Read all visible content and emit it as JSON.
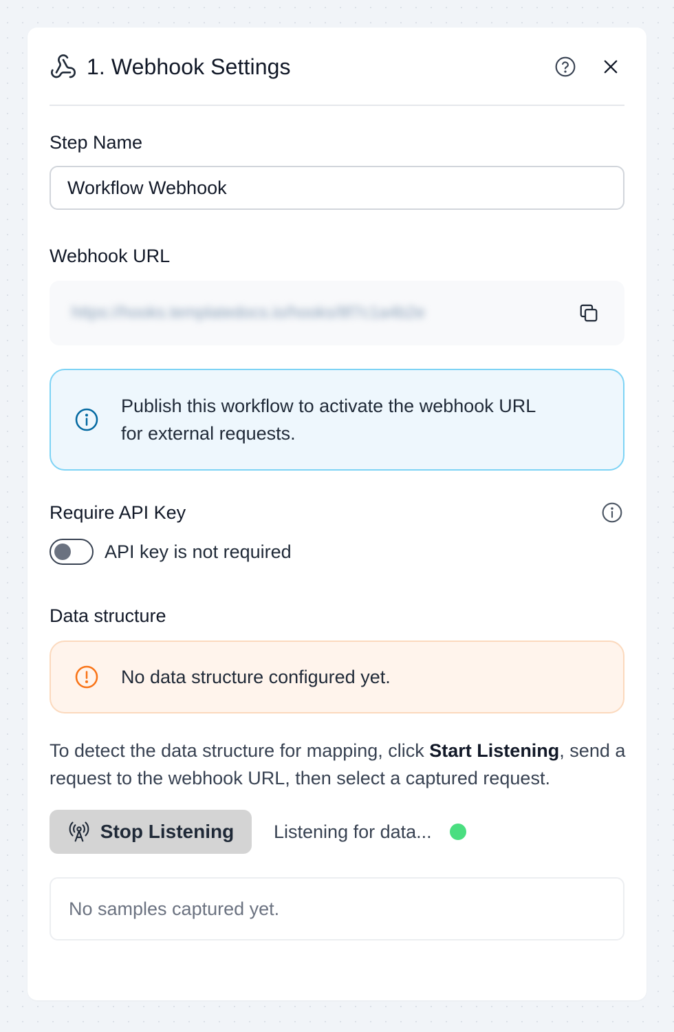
{
  "header": {
    "title": "1. Webhook Settings",
    "title_icon": "webhook-icon",
    "help_icon": "help-circle-icon",
    "close_icon": "close-icon"
  },
  "step_name": {
    "label": "Step Name",
    "value": "Workflow Webhook"
  },
  "webhook_url": {
    "label": "Webhook URL",
    "value": "https://hooks.templatedocs.io/hooks/8f7c1a4b2e",
    "copy_icon": "copy-icon"
  },
  "publish_notice": {
    "icon": "info-circle-icon",
    "line1": "Publish this workflow to activate the webhook URL",
    "line2": "for external requests."
  },
  "api_key": {
    "label": "Require API Key",
    "info_icon": "info-circle-icon",
    "toggle_on": false,
    "toggle_text": "API key is not required"
  },
  "data_structure": {
    "label": "Data structure",
    "warning_icon": "alert-circle-icon",
    "warning": "No data structure configured yet.",
    "desc_before": "To detect the data structure for mapping, click ",
    "desc_bold": "Start Listening",
    "desc_after": ", send a request to the webhook URL, then select a captured request."
  },
  "listening": {
    "button_icon": "broadcast-icon",
    "button_label": "Stop Listening",
    "status_text": "Listening for data...",
    "status_color": "#4ade80"
  },
  "samples": {
    "empty_text": "No samples captured yet."
  },
  "colors": {
    "info_bg": "#eef7fd",
    "info_border": "#7dd3f5",
    "info_icon": "#0369a1",
    "warn_bg": "#fff4ec",
    "warn_border": "#fbd9bd",
    "warn_icon": "#f97316"
  }
}
